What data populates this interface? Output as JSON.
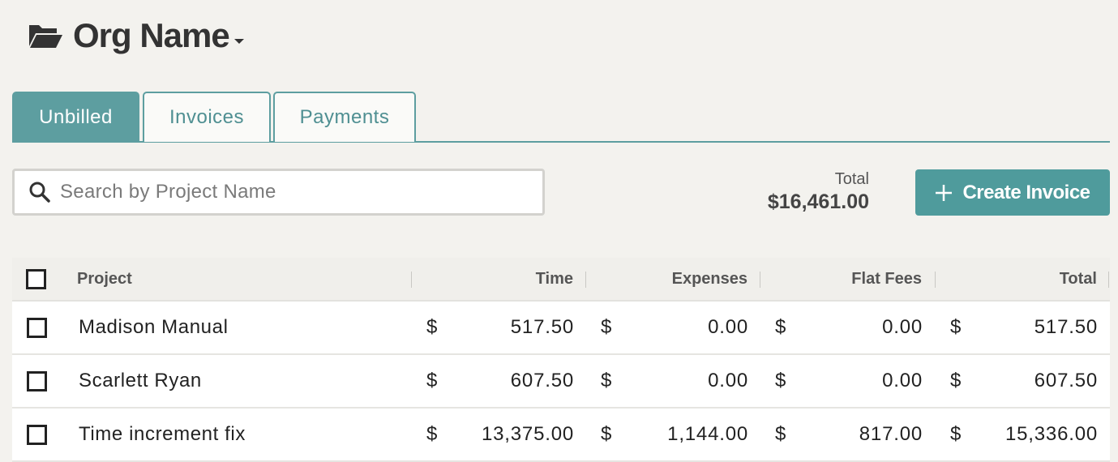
{
  "header": {
    "org_name": "Org Name",
    "folder_icon": "folder-open-icon",
    "caret_icon": "caret-down-icon"
  },
  "tabs": [
    {
      "label": "Unbilled",
      "active": true
    },
    {
      "label": "Invoices",
      "active": false
    },
    {
      "label": "Payments",
      "active": false
    }
  ],
  "search": {
    "placeholder": "Search by Project Name",
    "value": "",
    "icon": "search-icon"
  },
  "summary": {
    "total_label": "Total",
    "total_value": "$16,461.00"
  },
  "create_button": {
    "label": "Create Invoice",
    "icon": "plus-icon"
  },
  "colors": {
    "accent": "#5d9ea0",
    "button": "#4f9b9c",
    "background": "#f3f2ee"
  },
  "table": {
    "columns": [
      "Project",
      "Time",
      "Expenses",
      "Flat Fees",
      "Total"
    ],
    "currency_symbol": "$",
    "rows": [
      {
        "project": "Madison Manual",
        "time": "517.50",
        "expenses": "0.00",
        "flat_fees": "0.00",
        "total": "517.50"
      },
      {
        "project": "Scarlett Ryan",
        "time": "607.50",
        "expenses": "0.00",
        "flat_fees": "0.00",
        "total": "607.50"
      },
      {
        "project": "Time increment fix",
        "time": "13,375.00",
        "expenses": "1,144.00",
        "flat_fees": "817.00",
        "total": "15,336.00"
      }
    ]
  }
}
